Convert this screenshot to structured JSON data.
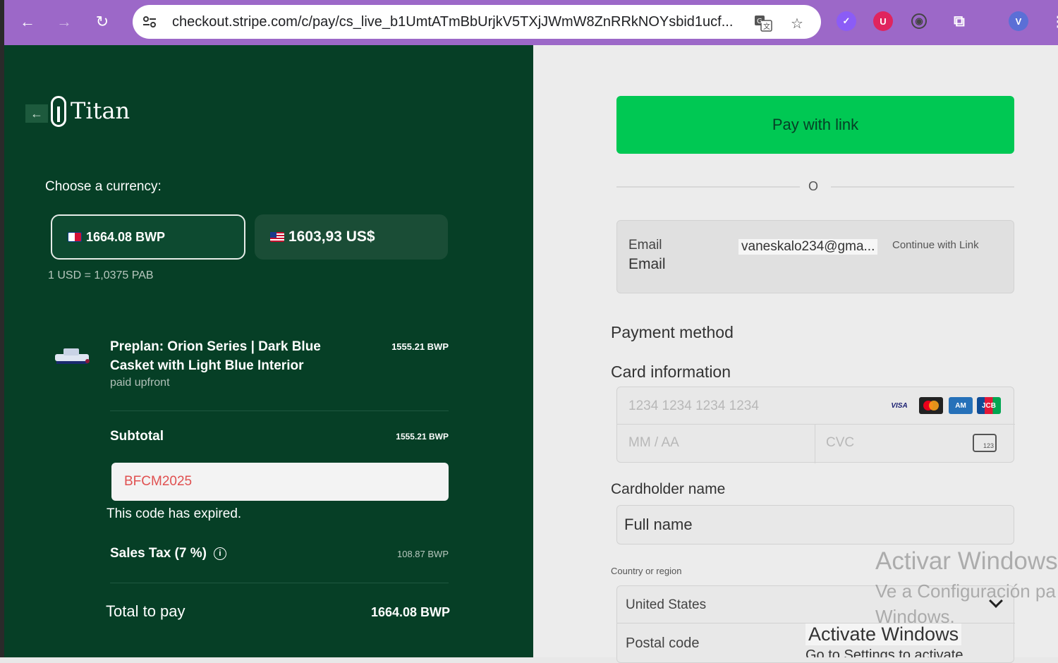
{
  "browser": {
    "url": "checkout.stripe.com/c/pay/cs_live_b1UmtATmBbUrjkV5TXjJWmW8ZnRRkNOYsbid1ucf..."
  },
  "merchant": {
    "name": "Titan"
  },
  "currency": {
    "label": "Choose a currency:",
    "options": [
      {
        "amount": "1664.08 BWP",
        "selected": true,
        "flag": "panama"
      },
      {
        "amount": "1603,93 US$",
        "selected": false,
        "flag": "usa"
      }
    ],
    "rate": "1 USD = 1,0375 PAB"
  },
  "product": {
    "name": "Preplan: Orion Series | Dark Blue Casket with Light Blue Interior",
    "subtitle": "paid upfront",
    "price": "1555.21 BWP"
  },
  "summary": {
    "subtotal_label": "Subtotal",
    "subtotal_value": "1555.21 BWP",
    "promo_code": "BFCM2025",
    "promo_error": "This code has expired.",
    "tax_label": "Sales Tax (7 %)",
    "tax_value": "108.87 BWP",
    "total_label": "Total to pay",
    "total_value": "1664.08 BWP"
  },
  "payment": {
    "pay_with_link": "Pay with link",
    "or_text": "O",
    "email_label": "Email",
    "email_label_2": "Email",
    "email_value": "vaneskalo234@gma...",
    "continue_link": "Continue with Link",
    "method_title": "Payment method",
    "card_title": "Card information",
    "card_number_placeholder": "1234 1234 1234 1234",
    "expiry_placeholder": "MM / AA",
    "cvc_placeholder": "CVC",
    "cardholder_title": "Cardholder name",
    "cardholder_placeholder": "Full name",
    "country_label": "Country or region",
    "country_value": "United States",
    "postal_placeholder": "Postal code",
    "brands": [
      "VISA",
      "mastercard-icon",
      "amex-icon",
      "jcb-icon"
    ]
  },
  "watermark": {
    "line1": "Activar Windows",
    "line2": "Ve a Configuración pa",
    "line3": "Windows.",
    "line4": "Activate Windows",
    "line5": "Go to Settings to activate"
  },
  "colors": {
    "left_bg": "#063f26",
    "link_green": "#00c853",
    "chrome_purple": "#9c68c8",
    "error_red": "#e05050"
  }
}
